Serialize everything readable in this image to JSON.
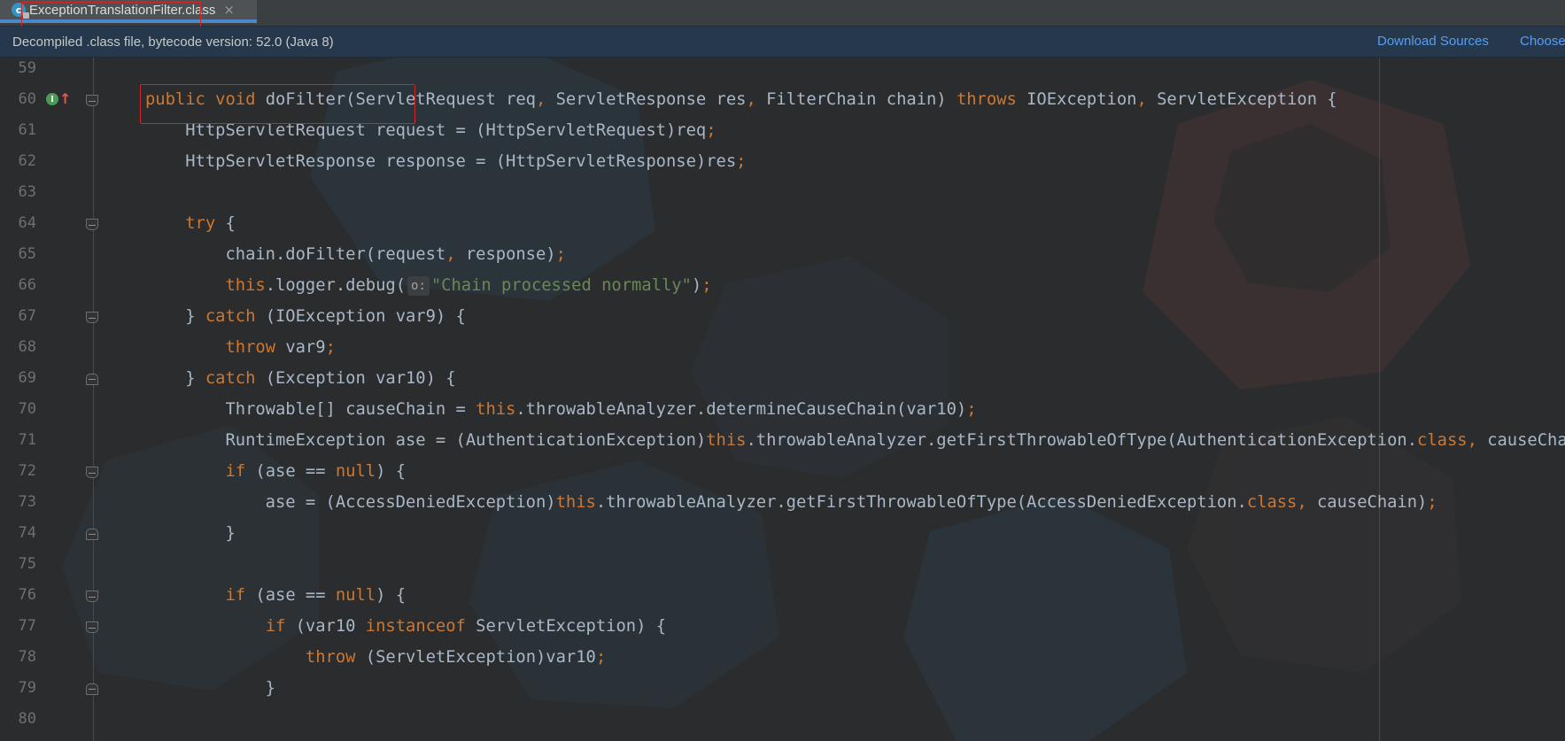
{
  "tab": {
    "title": "ExceptionTranslationFilter.class",
    "icon": "c-class-icon",
    "close": "×"
  },
  "infobar": {
    "text": "Decompiled .class file, bytecode version: 52.0 (Java 8)",
    "download_sources": "Download Sources",
    "choose_sources": "Choose"
  },
  "gutter": {
    "implements_badge": "I",
    "implements_arrow": "↑"
  },
  "lines": [
    {
      "n": "59",
      "fold": "",
      "code": ""
    },
    {
      "n": "60",
      "fold": "start",
      "code": "<span class='kw'>public void</span> doFilter(ServletRequest req<span class='kw'>,</span> ServletResponse res<span class='kw'>,</span> FilterChain chain) <span class='kw'>throws</span> IOException<span class='kw'>,</span> ServletException {"
    },
    {
      "n": "61",
      "fold": "",
      "code": "    HttpServletRequest request = (HttpServletRequest)req<span class='kw'>;</span>"
    },
    {
      "n": "62",
      "fold": "",
      "code": "    HttpServletResponse response = (HttpServletResponse)res<span class='kw'>;</span>"
    },
    {
      "n": "63",
      "fold": "",
      "code": ""
    },
    {
      "n": "64",
      "fold": "start",
      "code": "    <span class='kw'>try</span> {"
    },
    {
      "n": "65",
      "fold": "",
      "code": "        chain.doFilter(request<span class='kw'>,</span> response)<span class='kw'>;</span>"
    },
    {
      "n": "66",
      "fold": "",
      "code": "        <span class='kw'>this</span>.logger.debug(<span class='hint'>o:</span><span class='str'>\"Chain processed normally\"</span>)<span class='kw'>;</span>"
    },
    {
      "n": "67",
      "fold": "start",
      "code": "    } <span class='kw'>catch</span> (IOException var9) {"
    },
    {
      "n": "68",
      "fold": "",
      "code": "        <span class='kw'>throw</span> var9<span class='kw'>;</span>"
    },
    {
      "n": "69",
      "fold": "end",
      "code": "    } <span class='kw'>catch</span> (Exception var10) {"
    },
    {
      "n": "70",
      "fold": "",
      "code": "        Throwable[] causeChain = <span class='kw'>this</span>.throwableAnalyzer.determineCauseChain(var10)<span class='kw'>;</span>"
    },
    {
      "n": "71",
      "fold": "",
      "code": "        RuntimeException ase = (AuthenticationException)<span class='kw'>this</span>.throwableAnalyzer.getFirstThrowableOfType(AuthenticationException.<span class='kw'>class,</span> causeChain)<span class='kw'>;</span>"
    },
    {
      "n": "72",
      "fold": "start",
      "code": "        <span class='kw'>if</span> (ase == <span class='kw'>null</span>) {"
    },
    {
      "n": "73",
      "fold": "",
      "code": "            ase = (AccessDeniedException)<span class='kw'>this</span>.throwableAnalyzer.getFirstThrowableOfType(AccessDeniedException.<span class='kw'>class,</span> causeChain)<span class='kw'>;</span>"
    },
    {
      "n": "74",
      "fold": "end",
      "code": "        }"
    },
    {
      "n": "75",
      "fold": "",
      "code": ""
    },
    {
      "n": "76",
      "fold": "start",
      "code": "        <span class='kw'>if</span> (ase == <span class='kw'>null</span>) {"
    },
    {
      "n": "77",
      "fold": "start",
      "code": "            <span class='kw'>if</span> (var10 <span class='kw'>instanceof</span> ServletException) {"
    },
    {
      "n": "78",
      "fold": "",
      "code": "                <span class='kw'>throw</span> (ServletException)var10<span class='kw'>;</span>"
    },
    {
      "n": "79",
      "fold": "end",
      "code": "            }"
    },
    {
      "n": "80",
      "fold": "",
      "code": ""
    }
  ]
}
